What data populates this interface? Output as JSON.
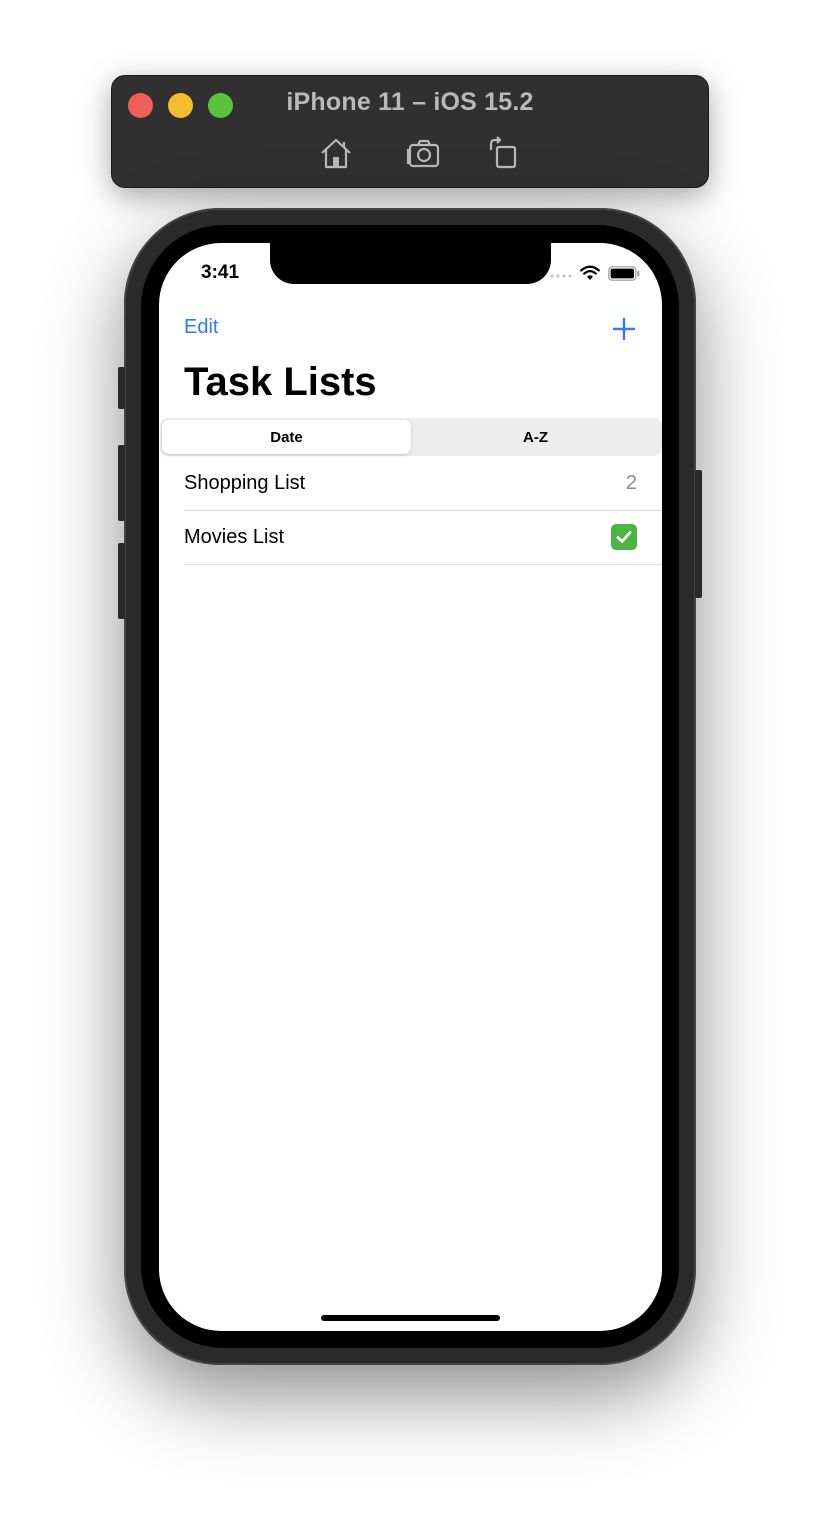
{
  "window": {
    "title": "iPhone 11 – iOS 15.2",
    "toolbar_icons": [
      "home-icon",
      "screenshot-icon",
      "rotate-icon"
    ]
  },
  "status_bar": {
    "time": "3:41"
  },
  "nav": {
    "edit_label": "Edit",
    "add_icon": "plus-icon"
  },
  "page": {
    "title": "Task Lists"
  },
  "segments": [
    {
      "label": "Date",
      "selected": true
    },
    {
      "label": "A-Z",
      "selected": false
    }
  ],
  "lists": [
    {
      "name": "Shopping List",
      "count": "2"
    },
    {
      "name": "Movies List",
      "status": "check-mark-icon"
    }
  ],
  "colors": {
    "accent": "#2f7bf6",
    "check": "#4bb543"
  }
}
